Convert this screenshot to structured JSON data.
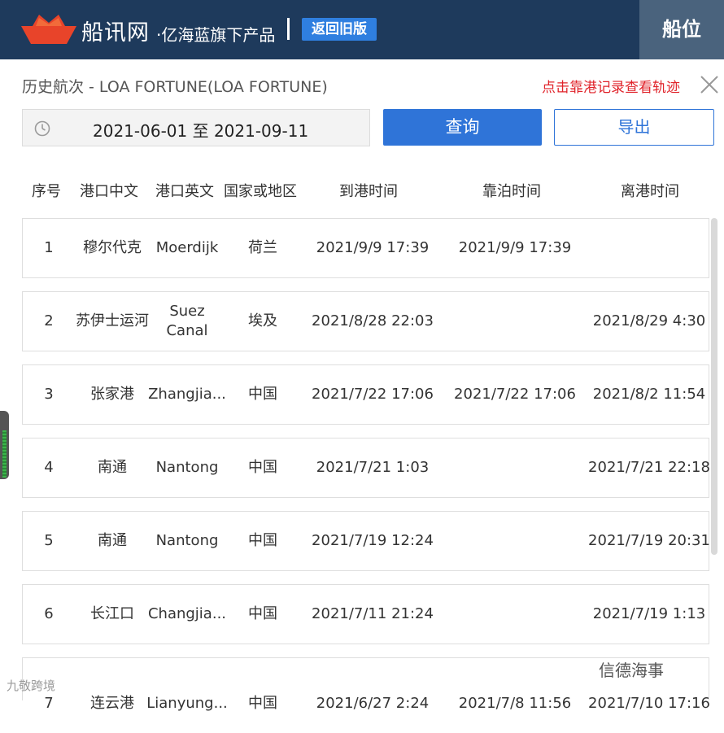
{
  "header": {
    "brand_name": "船讯网",
    "brand_sub": "·亿海蓝旗下产品",
    "old_version_label": "返回旧版",
    "position_tab_label": "船位"
  },
  "panel": {
    "title": "历史航次 - LOA FORTUNE(LOA FORTUNE)",
    "track_link": "点击靠港记录查看轨迹",
    "date_range": "2021-06-01 至 2021-09-11",
    "query_label": "查询",
    "export_label": "导出"
  },
  "table": {
    "headers": [
      "序号",
      "港口中文",
      "港口英文",
      "国家或地区",
      "到港时间",
      "靠泊时间",
      "离港时间"
    ],
    "rows": [
      {
        "no": "1",
        "port_cn": "穆尔代克",
        "port_en": "Moerdijk",
        "country": "荷兰",
        "arrival": "2021/9/9 17:39",
        "berth": "2021/9/9 17:39",
        "departure": ""
      },
      {
        "no": "2",
        "port_cn": "苏伊士运河",
        "port_en": "Suez\nCanal",
        "port_en_l1": "Suez",
        "port_en_l2": "Canal",
        "country": "埃及",
        "arrival": "2021/8/28 22:03",
        "berth": "",
        "departure": "2021/8/29 4:30"
      },
      {
        "no": "3",
        "port_cn": "张家港",
        "port_en": "Zhangjia...",
        "country": "中国",
        "arrival": "2021/7/22 17:06",
        "berth": "2021/7/22 17:06",
        "departure": "2021/8/2 11:54"
      },
      {
        "no": "4",
        "port_cn": "南通",
        "port_en": "Nantong",
        "country": "中国",
        "arrival": "2021/7/21 1:03",
        "berth": "",
        "departure": "2021/7/21 22:18"
      },
      {
        "no": "5",
        "port_cn": "南通",
        "port_en": "Nantong",
        "country": "中国",
        "arrival": "2021/7/19 12:24",
        "berth": "",
        "departure": "2021/7/19 20:31"
      },
      {
        "no": "6",
        "port_cn": "长江口",
        "port_en": "Changjia...",
        "country": "中国",
        "arrival": "2021/7/11 21:24",
        "berth": "",
        "departure": "2021/7/19 1:13"
      },
      {
        "no": "7",
        "port_cn": "连云港",
        "port_en": "Lianyung...",
        "country": "中国",
        "arrival": "2021/6/27 2:24",
        "berth": "2021/7/8 11:56",
        "departure": "2021/7/10 17:16"
      }
    ]
  },
  "watermarks": {
    "right": "信德海事",
    "left": "九敬跨境"
  },
  "colors": {
    "header_bg": "#1e3a5c",
    "position_tab_bg": "#4a637d",
    "primary_blue": "#2f74d8",
    "link_red": "#e0242b"
  },
  "icons": [
    "ship-logo-icon",
    "clock-icon",
    "close-icon"
  ]
}
